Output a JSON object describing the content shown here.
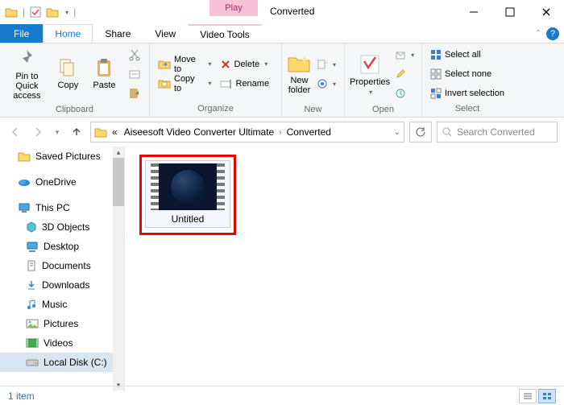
{
  "window": {
    "title": "Converted",
    "contextual_tab": "Play",
    "file_tab": "File",
    "tabs": [
      "Home",
      "Share",
      "View",
      "Video Tools"
    ],
    "active_tab": "Home"
  },
  "ribbon": {
    "clipboard": {
      "pin": "Pin to Quick access",
      "copy": "Copy",
      "paste": "Paste",
      "label": "Clipboard"
    },
    "organize": {
      "move": "Move to",
      "copy": "Copy to",
      "delete": "Delete",
      "rename": "Rename",
      "label": "Organize"
    },
    "new": {
      "folder": "New folder",
      "label": "New"
    },
    "open": {
      "properties": "Properties",
      "label": "Open"
    },
    "select": {
      "all": "Select all",
      "none": "Select none",
      "invert": "Invert selection",
      "label": "Select"
    }
  },
  "address": {
    "prefix": "«",
    "crumb1": "Aiseesoft Video Converter Ultimate",
    "crumb2": "Converted"
  },
  "search": {
    "placeholder": "Search Converted"
  },
  "tree": {
    "items": [
      {
        "label": "Saved Pictures",
        "icon": "folder"
      },
      {
        "label": "OneDrive",
        "icon": "onedrive"
      },
      {
        "label": "This PC",
        "icon": "pc"
      },
      {
        "label": "3D Objects",
        "icon": "3d",
        "lvl": 1
      },
      {
        "label": "Desktop",
        "icon": "desktop",
        "lvl": 1
      },
      {
        "label": "Documents",
        "icon": "doc",
        "lvl": 1
      },
      {
        "label": "Downloads",
        "icon": "down",
        "lvl": 1
      },
      {
        "label": "Music",
        "icon": "music",
        "lvl": 1
      },
      {
        "label": "Pictures",
        "icon": "pic",
        "lvl": 1
      },
      {
        "label": "Videos",
        "icon": "vid",
        "lvl": 1
      },
      {
        "label": "Local Disk (C:)",
        "icon": "disk",
        "lvl": 1,
        "sel": true
      }
    ]
  },
  "file": {
    "name": "Untitled"
  },
  "status": {
    "text": "1 item"
  }
}
